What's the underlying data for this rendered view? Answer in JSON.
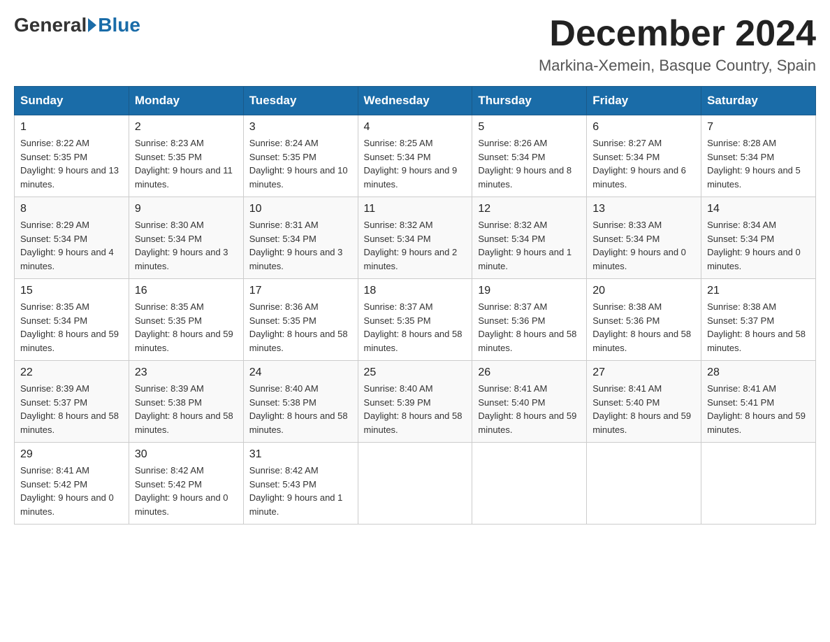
{
  "logo": {
    "general": "General",
    "blue": "Blue"
  },
  "header": {
    "month": "December 2024",
    "location": "Markina-Xemein, Basque Country, Spain"
  },
  "days_of_week": [
    "Sunday",
    "Monday",
    "Tuesday",
    "Wednesday",
    "Thursday",
    "Friday",
    "Saturday"
  ],
  "weeks": [
    [
      {
        "day": "1",
        "sunrise": "8:22 AM",
        "sunset": "5:35 PM",
        "daylight": "9 hours and 13 minutes."
      },
      {
        "day": "2",
        "sunrise": "8:23 AM",
        "sunset": "5:35 PM",
        "daylight": "9 hours and 11 minutes."
      },
      {
        "day": "3",
        "sunrise": "8:24 AM",
        "sunset": "5:35 PM",
        "daylight": "9 hours and 10 minutes."
      },
      {
        "day": "4",
        "sunrise": "8:25 AM",
        "sunset": "5:34 PM",
        "daylight": "9 hours and 9 minutes."
      },
      {
        "day": "5",
        "sunrise": "8:26 AM",
        "sunset": "5:34 PM",
        "daylight": "9 hours and 8 minutes."
      },
      {
        "day": "6",
        "sunrise": "8:27 AM",
        "sunset": "5:34 PM",
        "daylight": "9 hours and 6 minutes."
      },
      {
        "day": "7",
        "sunrise": "8:28 AM",
        "sunset": "5:34 PM",
        "daylight": "9 hours and 5 minutes."
      }
    ],
    [
      {
        "day": "8",
        "sunrise": "8:29 AM",
        "sunset": "5:34 PM",
        "daylight": "9 hours and 4 minutes."
      },
      {
        "day": "9",
        "sunrise": "8:30 AM",
        "sunset": "5:34 PM",
        "daylight": "9 hours and 3 minutes."
      },
      {
        "day": "10",
        "sunrise": "8:31 AM",
        "sunset": "5:34 PM",
        "daylight": "9 hours and 3 minutes."
      },
      {
        "day": "11",
        "sunrise": "8:32 AM",
        "sunset": "5:34 PM",
        "daylight": "9 hours and 2 minutes."
      },
      {
        "day": "12",
        "sunrise": "8:32 AM",
        "sunset": "5:34 PM",
        "daylight": "9 hours and 1 minute."
      },
      {
        "day": "13",
        "sunrise": "8:33 AM",
        "sunset": "5:34 PM",
        "daylight": "9 hours and 0 minutes."
      },
      {
        "day": "14",
        "sunrise": "8:34 AM",
        "sunset": "5:34 PM",
        "daylight": "9 hours and 0 minutes."
      }
    ],
    [
      {
        "day": "15",
        "sunrise": "8:35 AM",
        "sunset": "5:34 PM",
        "daylight": "8 hours and 59 minutes."
      },
      {
        "day": "16",
        "sunrise": "8:35 AM",
        "sunset": "5:35 PM",
        "daylight": "8 hours and 59 minutes."
      },
      {
        "day": "17",
        "sunrise": "8:36 AM",
        "sunset": "5:35 PM",
        "daylight": "8 hours and 58 minutes."
      },
      {
        "day": "18",
        "sunrise": "8:37 AM",
        "sunset": "5:35 PM",
        "daylight": "8 hours and 58 minutes."
      },
      {
        "day": "19",
        "sunrise": "8:37 AM",
        "sunset": "5:36 PM",
        "daylight": "8 hours and 58 minutes."
      },
      {
        "day": "20",
        "sunrise": "8:38 AM",
        "sunset": "5:36 PM",
        "daylight": "8 hours and 58 minutes."
      },
      {
        "day": "21",
        "sunrise": "8:38 AM",
        "sunset": "5:37 PM",
        "daylight": "8 hours and 58 minutes."
      }
    ],
    [
      {
        "day": "22",
        "sunrise": "8:39 AM",
        "sunset": "5:37 PM",
        "daylight": "8 hours and 58 minutes."
      },
      {
        "day": "23",
        "sunrise": "8:39 AM",
        "sunset": "5:38 PM",
        "daylight": "8 hours and 58 minutes."
      },
      {
        "day": "24",
        "sunrise": "8:40 AM",
        "sunset": "5:38 PM",
        "daylight": "8 hours and 58 minutes."
      },
      {
        "day": "25",
        "sunrise": "8:40 AM",
        "sunset": "5:39 PM",
        "daylight": "8 hours and 58 minutes."
      },
      {
        "day": "26",
        "sunrise": "8:41 AM",
        "sunset": "5:40 PM",
        "daylight": "8 hours and 59 minutes."
      },
      {
        "day": "27",
        "sunrise": "8:41 AM",
        "sunset": "5:40 PM",
        "daylight": "8 hours and 59 minutes."
      },
      {
        "day": "28",
        "sunrise": "8:41 AM",
        "sunset": "5:41 PM",
        "daylight": "8 hours and 59 minutes."
      }
    ],
    [
      {
        "day": "29",
        "sunrise": "8:41 AM",
        "sunset": "5:42 PM",
        "daylight": "9 hours and 0 minutes."
      },
      {
        "day": "30",
        "sunrise": "8:42 AM",
        "sunset": "5:42 PM",
        "daylight": "9 hours and 0 minutes."
      },
      {
        "day": "31",
        "sunrise": "8:42 AM",
        "sunset": "5:43 PM",
        "daylight": "9 hours and 1 minute."
      },
      null,
      null,
      null,
      null
    ]
  ],
  "labels": {
    "sunrise_prefix": "Sunrise: ",
    "sunset_prefix": "Sunset: ",
    "daylight_prefix": "Daylight: "
  }
}
